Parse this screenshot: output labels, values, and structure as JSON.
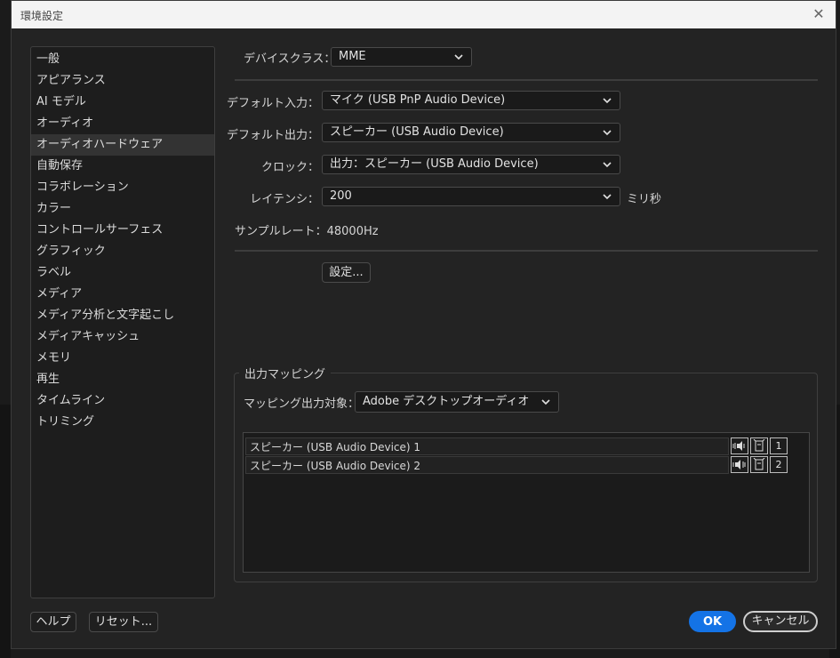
{
  "window": {
    "title": "環境設定",
    "close_glyph": "✕"
  },
  "sidebar": {
    "selected_index": 4,
    "items": [
      {
        "label": "一般"
      },
      {
        "label": "アピアランス"
      },
      {
        "label": "AI モデル"
      },
      {
        "label": "オーディオ"
      },
      {
        "label": "オーディオハードウェア"
      },
      {
        "label": "自動保存"
      },
      {
        "label": "コラボレーション"
      },
      {
        "label": "カラー"
      },
      {
        "label": "コントロールサーフェス"
      },
      {
        "label": "グラフィック"
      },
      {
        "label": "ラベル"
      },
      {
        "label": "メディア"
      },
      {
        "label": "メディア分析と文字起こし"
      },
      {
        "label": "メディアキャッシュ"
      },
      {
        "label": "メモリ"
      },
      {
        "label": "再生"
      },
      {
        "label": "タイムライン"
      },
      {
        "label": "トリミング"
      }
    ]
  },
  "audio": {
    "device_class": {
      "label": "デバイスクラス：",
      "value": "MME"
    },
    "default_input": {
      "label": "デフォルト入力：",
      "value": "マイク (USB PnP Audio Device)"
    },
    "default_output": {
      "label": "デフォルト出力：",
      "value": "スピーカー (USB Audio Device)"
    },
    "clock": {
      "label": "クロック：",
      "value": "出力：スピーカー (USB Audio Device)"
    },
    "latency": {
      "label": "レイテンシ：",
      "value": "200",
      "unit": "ミリ秒"
    },
    "sample_rate": "サンプルレート：48000Hz",
    "settings_button": "設定..."
  },
  "mapping": {
    "group_title": "出力マッピング",
    "target_label": "マッピング出力対象：",
    "target_value": "Adobe デスクトップオーディオ",
    "rows": [
      {
        "name": "スピーカー (USB Audio Device) 1",
        "channel": "1",
        "speaker_icon": "speaker-left-icon"
      },
      {
        "name": "スピーカー (USB Audio Device) 2",
        "channel": "2",
        "speaker_icon": "speaker-right-icon"
      }
    ]
  },
  "footer": {
    "help": "ヘルプ",
    "reset": "リセット...",
    "ok": "OK",
    "cancel": "キャンセル"
  },
  "colors": {
    "accent": "#1473e6",
    "panel": "#232323",
    "selected": "#333333"
  }
}
